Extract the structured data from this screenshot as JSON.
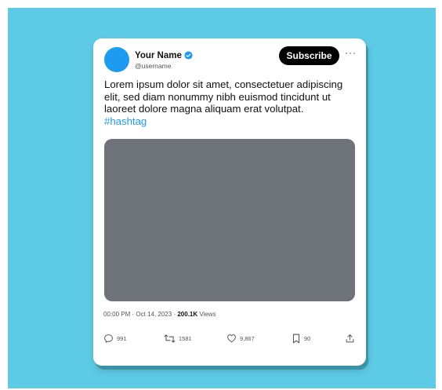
{
  "tweet": {
    "display_name": "Your Name",
    "username": "@username",
    "subscribe_label": "Subscribe",
    "more_label": "···",
    "text": "Lorem ipsum dolor sit amet, consectetuer adipiscing elit, sed diam nonummy nibh euismod tincidunt ut laoreet dolore magna aliquam erat volutpat.",
    "hashtag": "#hashtag",
    "time": "00:00 PM",
    "date": "Oct 14, 2023",
    "views_count": "200.1K",
    "views_label": "Views",
    "separator": "·"
  },
  "actions": {
    "replies": "991",
    "retweets": "1581",
    "likes": "9,867",
    "bookmarks": "90"
  },
  "colors": {
    "backdrop": "#5ecbe6",
    "accent": "#1d9bf0",
    "media_placeholder": "#6e737a"
  }
}
